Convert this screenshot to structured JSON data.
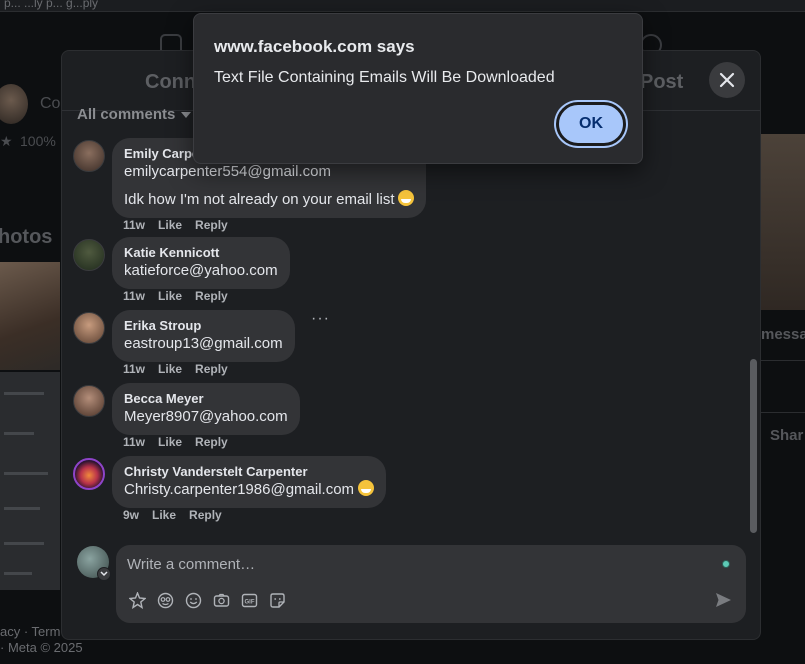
{
  "background": {
    "topbar_text": "p... ...ly p... g...ply",
    "page_name_fragment": "Co",
    "percent": "100%",
    "photos_heading": "hotos",
    "message_fragment": "messa",
    "share_fragment": "Shar",
    "footer_line1": "acy · Term",
    "footer_line2": "· Meta © 2025"
  },
  "dialog": {
    "title_left": "Conn",
    "title_right": "Post",
    "filter_label": "All comments"
  },
  "comments": [
    {
      "name": "Emily Carpe",
      "lines": [
        "emilycarpenter554@gmail.com",
        "Idk how I'm not already on your email list"
      ],
      "emoji": "grinning-squinting-emoji",
      "time": "11w",
      "like": "Like",
      "reply": "Reply"
    },
    {
      "name": "Katie Kennicott",
      "lines": [
        "katieforce@yahoo.com"
      ],
      "time": "11w",
      "like": "Like",
      "reply": "Reply"
    },
    {
      "name": "Erika Stroup",
      "lines": [
        "eastroup13@gmail.com"
      ],
      "time": "11w",
      "like": "Like",
      "reply": "Reply",
      "more": "···"
    },
    {
      "name": "Becca Meyer",
      "lines": [
        "Meyer8907@yahoo.com"
      ],
      "time": "11w",
      "like": "Like",
      "reply": "Reply"
    },
    {
      "name": "Christy Vanderstelt Carpenter",
      "lines": [
        "Christy.carpenter1986@gmail.com"
      ],
      "emoji": "grinning-emoji",
      "time": "9w",
      "like": "Like",
      "reply": "Reply"
    }
  ],
  "composer": {
    "placeholder": "Write a comment…",
    "icons": [
      "avatar-sticker-icon",
      "emoji-face-icon",
      "smiley-icon",
      "camera-icon",
      "gif-icon",
      "sticker-icon"
    ],
    "send_icon": "send-icon"
  },
  "alert": {
    "title": "www.facebook.com says",
    "message": "Text File Containing Emails Will Be Downloaded",
    "ok_label": "OK"
  },
  "colors": {
    "accent": "#a8c7fa",
    "bubble": "#333437",
    "dialog_bg": "#1d1f22"
  }
}
